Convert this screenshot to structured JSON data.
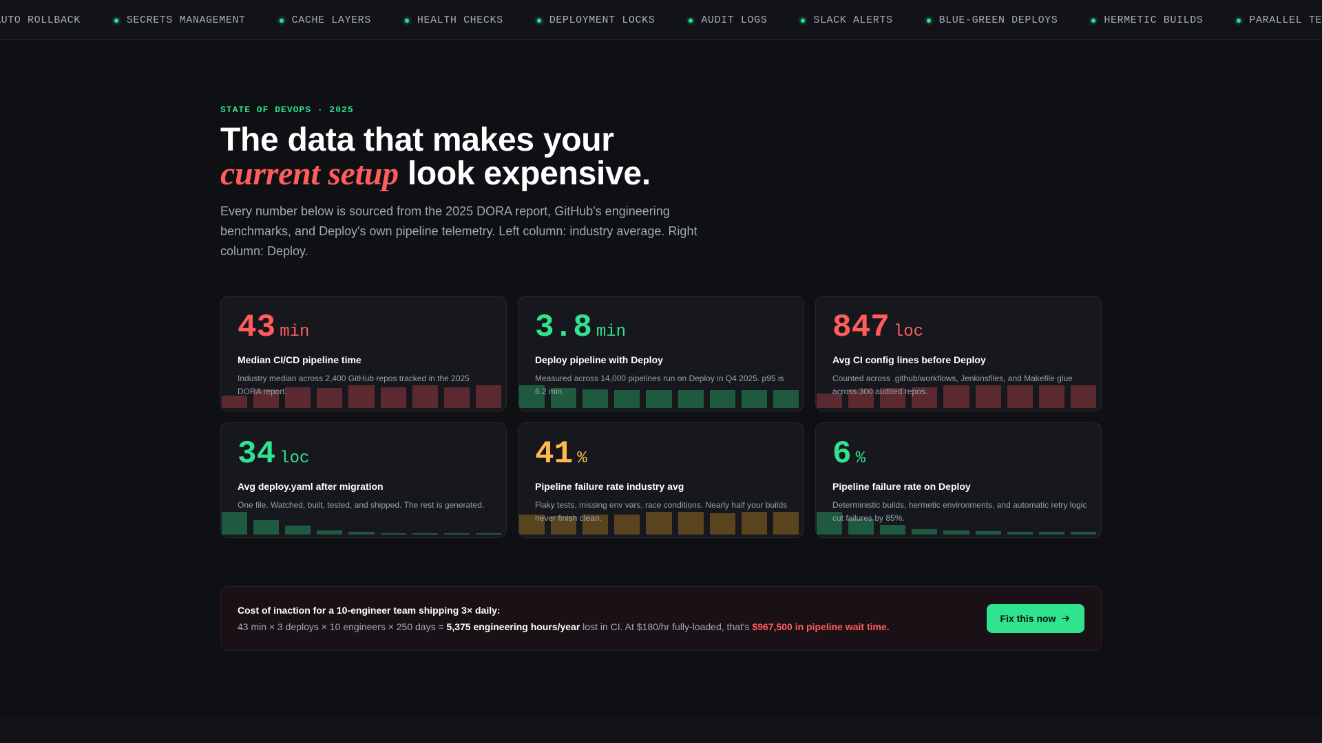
{
  "ticker": {
    "items": [
      "AUTO ROLLBACK",
      "SECRETS MANAGEMENT",
      "CACHE LAYERS",
      "HEALTH CHECKS",
      "DEPLOYMENT LOCKS",
      "AUDIT LOGS",
      "SLACK ALERTS",
      "BLUE-GREEN DEPLOYS",
      "HERMETIC BUILDS",
      "PARALLEL TEST SUITES"
    ]
  },
  "hero": {
    "eyebrow": "STATE OF DEVOPS · 2025",
    "headline_line1": "The data that makes your",
    "headline_accent": "current setup",
    "headline_rest": "look expensive.",
    "subtext": "Every number below is sourced from the 2025 DORA report, GitHub's engineering benchmarks, and Deploy's own pipeline telemetry. Left column: industry average. Right column: Deploy."
  },
  "cards": [
    {
      "value": "43",
      "unit": "min",
      "tone": "red",
      "title": "Median CI/CD pipeline time",
      "desc": "Industry median across 2,400 GitHub repos tracked in the 2025 DORA report.",
      "bar_color": "#5a2a30",
      "bars": [
        0.3,
        0.45,
        0.5,
        0.48,
        0.55,
        0.5,
        0.55,
        0.5,
        0.55
      ]
    },
    {
      "value": "3.8",
      "unit": "min",
      "tone": "green",
      "title": "Deploy pipeline with Deploy",
      "desc": "Measured across 14,000 pipelines run on Deploy in Q4 2025. p95 is 6.2 min.",
      "bar_color": "#1f5a40",
      "bars": [
        0.55,
        0.48,
        0.45,
        0.43,
        0.43,
        0.43,
        0.43,
        0.43,
        0.43
      ]
    },
    {
      "value": "847",
      "unit": "loc",
      "tone": "red",
      "title": "Avg CI config lines before Deploy",
      "desc": "Counted across .github/workflows, Jenkinsfiles, and Makefile glue across 300 audited repos.",
      "bar_color": "#5a2a30",
      "bars": [
        0.35,
        0.45,
        0.48,
        0.5,
        0.55,
        0.55,
        0.55,
        0.55,
        0.55
      ]
    },
    {
      "value": "34",
      "unit": "loc",
      "tone": "green",
      "title": "Avg deploy.yaml after migration",
      "desc": "One file. Watched, built, tested, and shipped. The rest is generated.",
      "bar_color": "#1f5a40",
      "bars": [
        0.55,
        0.35,
        0.22,
        0.1,
        0.06,
        0.04,
        0.03,
        0.03,
        0.03
      ]
    },
    {
      "value": "41",
      "unit": "%",
      "tone": "amber",
      "title": "Pipeline failure rate industry avg",
      "desc": "Flaky tests, missing env vars, race conditions. Nearly half your builds never finish clean.",
      "bar_color": "#5a4420",
      "bars": [
        0.48,
        0.45,
        0.48,
        0.48,
        0.55,
        0.55,
        0.52,
        0.55,
        0.55
      ]
    },
    {
      "value": "6",
      "unit": "%",
      "tone": "green",
      "title": "Pipeline failure rate on Deploy",
      "desc": "Deterministic builds, hermetic environments, and automatic retry logic cut failures by 85%.",
      "bar_color": "#1f5a40",
      "bars": [
        0.55,
        0.38,
        0.24,
        0.14,
        0.1,
        0.08,
        0.07,
        0.07,
        0.07
      ]
    }
  ],
  "cost": {
    "title": "Cost of inaction for a 10-engineer team shipping 3× daily:",
    "line_prefix": "43 min × 3 deploys × 10 engineers × 250 days = ",
    "line_hours": "5,375 engineering hours/year",
    "line_mid": " lost in CI. At $180/hr fully-loaded, that's ",
    "line_cost": "$967,500 in pipeline wait time.",
    "cta_label": "Fix this now",
    "cta_icon": "arrow-right-icon"
  }
}
